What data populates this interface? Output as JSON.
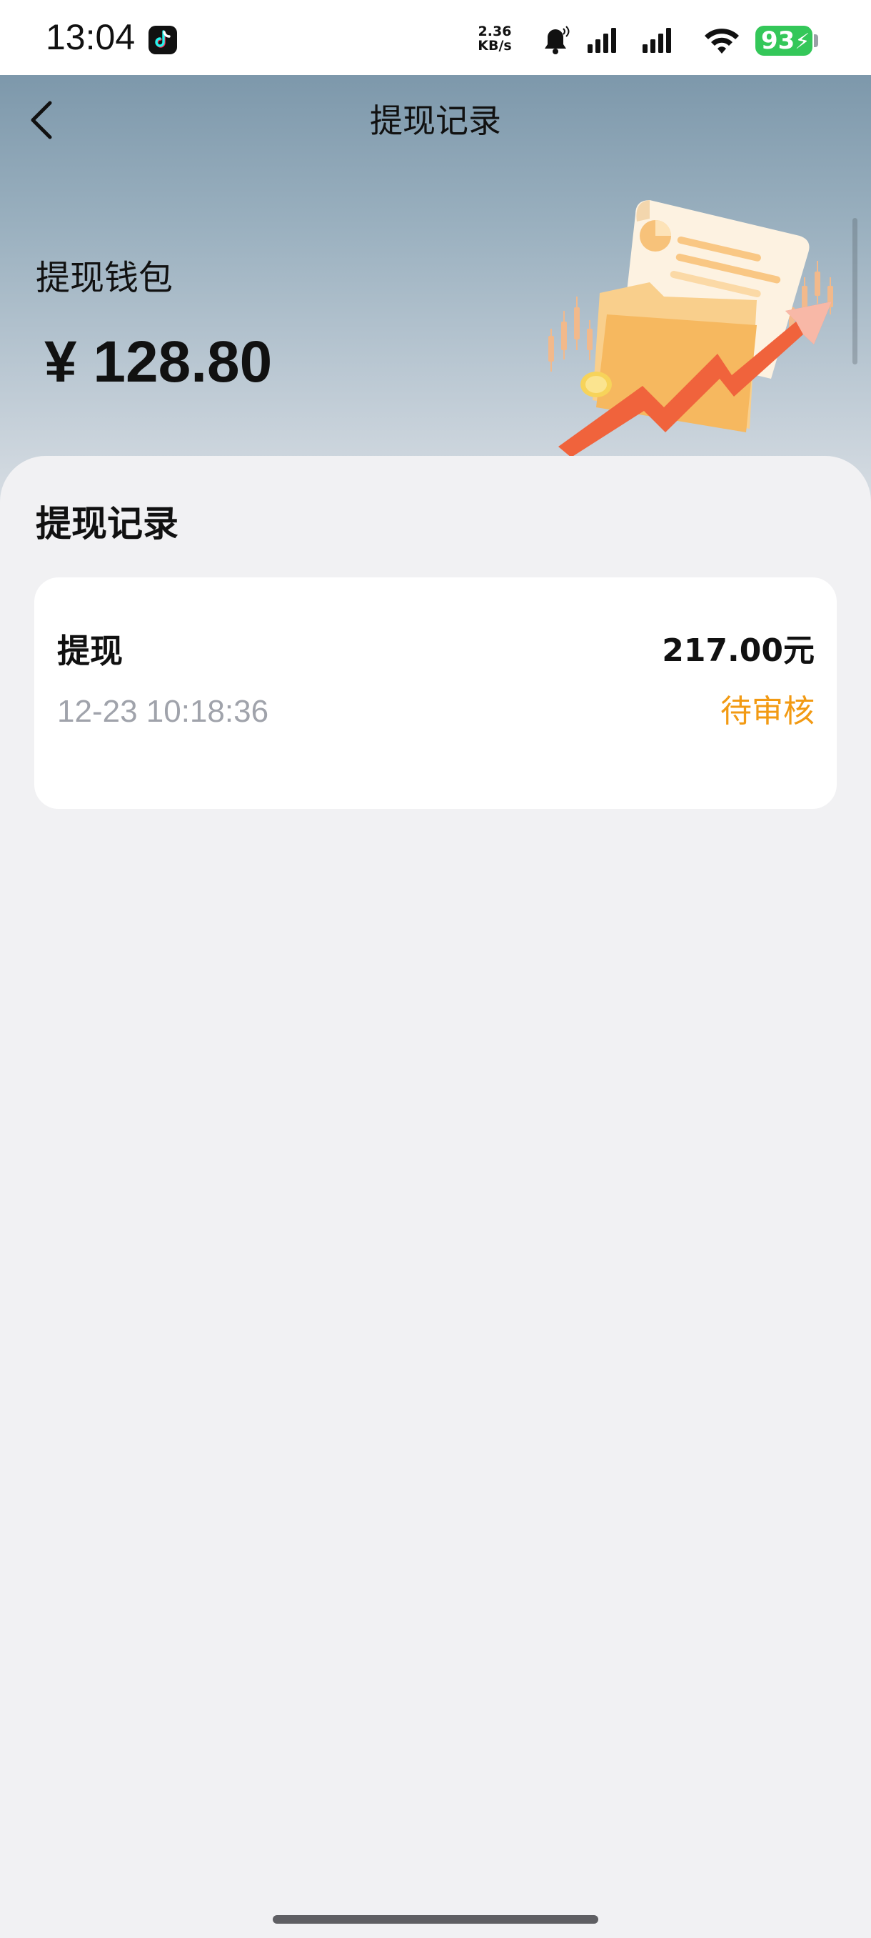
{
  "status_bar": {
    "time": "13:04",
    "net_speed_value": "2.36",
    "net_speed_unit": "KB/s",
    "battery": "93",
    "icons": [
      "tiktok-icon",
      "bell-icon",
      "signal-icon",
      "signal-icon",
      "wifi-icon",
      "battery-icon"
    ]
  },
  "header": {
    "title": "提现记录",
    "back_icon": "chevron-left-icon"
  },
  "wallet": {
    "label": "提现钱包",
    "amount": "¥ 128.80"
  },
  "records_section": {
    "title": "提现记录",
    "items": [
      {
        "type": "提现",
        "time": "12-23 10:18:36",
        "amount": "217.00元",
        "status": "待审核"
      }
    ]
  },
  "colors": {
    "status_pending": "#f29a13",
    "battery": "#34c759",
    "hero_top": "#7d98ab",
    "panel_bg": "#f1f1f3"
  }
}
